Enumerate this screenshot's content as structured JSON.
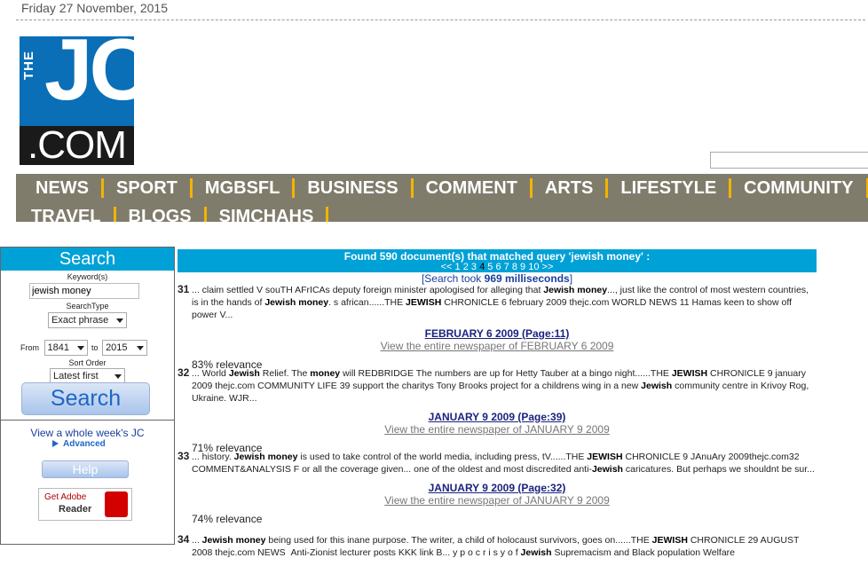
{
  "date": "Friday 27 November, 2015",
  "logo": {
    "the": "THE",
    "jc": "JC",
    "com": ".COM"
  },
  "colors": {
    "accent": "#00a1d6",
    "nav_bg": "#807c6c",
    "nav_separator": "#f2b400",
    "logo_blue": "#0a6fb7"
  },
  "nav": {
    "row1": [
      "NEWS",
      "SPORT",
      "MGBSFL",
      "BUSINESS",
      "COMMENT",
      "ARTS",
      "LIFESTYLE",
      "COMMUNITY"
    ],
    "row2": [
      "TRAVEL",
      "BLOGS",
      "SIMCHAHS"
    ]
  },
  "search_panel": {
    "title": "Search",
    "keyword_label": "Keyword(s)",
    "keyword_value": "jewish money",
    "searchtype_label": "SearchType",
    "searchtype_value": "Exact phrase",
    "from_label": "From",
    "from_value": "1841",
    "to_label": "to",
    "to_value": "2015",
    "sort_label": "Sort Order",
    "sort_value": "Latest first",
    "search_button": "Search",
    "week_link": "View a whole week's JC",
    "advanced_link": "Advanced",
    "help_button": "Help",
    "adobe_line1": "Get Adobe",
    "adobe_line2": "Reader"
  },
  "results_header": {
    "found_text": "Found 590 document(s) that matched query 'jewish money' :",
    "prev": "<<",
    "pages": [
      "1",
      "2",
      "3",
      "4",
      "5",
      "6",
      "7",
      "8",
      "9",
      "10"
    ],
    "current_page": "4",
    "next": ">>",
    "took_prefix": "[Search took ",
    "took_value": "969 milliseconds",
    "took_suffix": "]"
  },
  "results": [
    {
      "num": "31",
      "snippet_html": "... claim settled V souTH AFrICAs deputy foreign minister apologised for alleging that <b>Jewish money</b>..., just like the control of most western countries, is in the hands of <b>Jewish money</b>. s african......THE <b>JEWISH</b> CHRONICLE 6 february 2009 thejc.com WORLD NEWS 11 Hamas keen to show off power V...",
      "title": "FEBRUARY 6 2009 (Page:11)",
      "paper_link": "View the entire newspaper of FEBRUARY 6 2009",
      "relevance": "83% relevance"
    },
    {
      "num": "32",
      "snippet_html": "... World <b>Jewish</b> Relief. The <b>money</b> will REDBRIDGE The numbers are up for Hetty Tauber at a bingo night......THE <b>JEWISH</b> CHRONICLE 9 january 2009 thejc.com COMMUNITY LIFE 39 support the charitys Tony Brooks project for a childrens wing in a new <b>Jewish</b> community centre in Krivoy Rog, Ukraine. WJR...",
      "title": "JANUARY 9 2009 (Page:39)",
      "paper_link": "View the entire newspaper of JANUARY 9 2009",
      "relevance": "71% relevance"
    },
    {
      "num": "33",
      "snippet_html": "... history. <b>Jewish money</b> is used to take control of the world media, including press, tV......THE <b>JEWISH</b> CHRONICLE 9 JAnuAry 2009thejc.com32 COMMENT&amp;ANALYSIS F or all the coverage given... one of the oldest and most discredited anti-<b>Jewish</b> caricatures. But perhaps we shouldnt be sur...",
      "title": "JANUARY 9 2009 (Page:32)",
      "paper_link": "View the entire newspaper of JANUARY 9 2009",
      "relevance": "74% relevance"
    },
    {
      "num": "34",
      "snippet_html": "... <b>Jewish money</b> being used for this inane purpose. The writer, a child of holocaust survivors, goes on......THE <b>JEWISH</b> CHRONICLE 29 AUGUST 2008 thejc.com NEWS &nbsp;Anti-Zionist lecturer posts KKK link B... y p o c r i s y o f <b>Jewish</b> Supremacism and Black population Welfare",
      "title": "",
      "paper_link": "",
      "relevance": ""
    }
  ]
}
